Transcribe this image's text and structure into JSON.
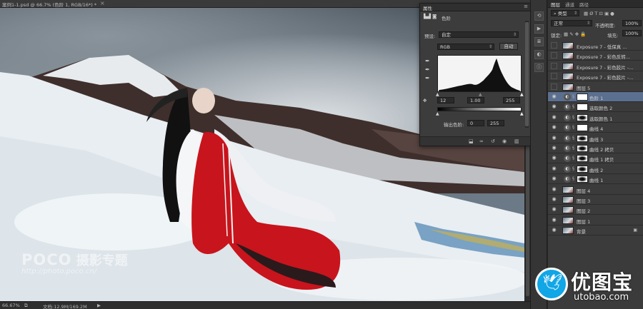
{
  "document": {
    "title": "案例1-1.psd @ 66.7% (色阶 1, RGB/16*) *",
    "close_glyph": "×"
  },
  "status_bar": {
    "zoom": "66.67%",
    "doc_size": "文档:12.9M/169.2M"
  },
  "watermark": {
    "brand": "POCO",
    "brand_cn": "摄影专题",
    "url": "http://photo.poco.cn/"
  },
  "properties": {
    "tab_label": "属性",
    "header_label": "色阶",
    "preset_label": "预设:",
    "preset_value": "自定",
    "channel_value": "RGB",
    "auto_button": "自动",
    "input_black": "12",
    "input_gamma": "1.00",
    "input_white": "255",
    "output_label": "输出色阶:",
    "output_black": "0",
    "output_white": "255"
  },
  "layers_panel": {
    "tabs": [
      "图层",
      "通道",
      "路径"
    ],
    "filter_type": "类型",
    "blend_mode": "正常",
    "opacity_label": "不透明度:",
    "opacity_value": "100%",
    "lock_label": "锁定:",
    "fill_label": "填充:",
    "fill_value": "100%",
    "layers": [
      {
        "name": "Exposure 7 - 低保真 ...",
        "visible": false,
        "kind": "image"
      },
      {
        "name": "Exposure 7 - 彩色反转...",
        "visible": false,
        "kind": "image"
      },
      {
        "name": "Exposure 7 - 彩色胶片 -...",
        "visible": false,
        "kind": "image"
      },
      {
        "name": "Exposure 7 - 彩色胶片 -...",
        "visible": false,
        "kind": "image"
      },
      {
        "name": "图层 5",
        "visible": false,
        "kind": "image"
      },
      {
        "name": "色阶 1",
        "visible": true,
        "kind": "adjust",
        "selected": true
      },
      {
        "name": "选取颜色 2",
        "visible": true,
        "kind": "adjust"
      },
      {
        "name": "选取颜色 1",
        "visible": true,
        "kind": "adjust",
        "dark_mask": true
      },
      {
        "name": "曲线 4",
        "visible": true,
        "kind": "adjust"
      },
      {
        "name": "曲线 3",
        "visible": true,
        "kind": "adjust",
        "dark_mask": true
      },
      {
        "name": "曲线 2 拷贝",
        "visible": true,
        "kind": "adjust",
        "dark_mask": true
      },
      {
        "name": "曲线 1 拷贝",
        "visible": true,
        "kind": "adjust",
        "dark_mask": true
      },
      {
        "name": "曲线 2",
        "visible": true,
        "kind": "adjust",
        "dark_mask": true
      },
      {
        "name": "曲线 1",
        "visible": true,
        "kind": "adjust",
        "dark_mask": true
      },
      {
        "name": "图层 4",
        "visible": true,
        "kind": "image"
      },
      {
        "name": "图层 3",
        "visible": true,
        "kind": "image"
      },
      {
        "name": "图层 2",
        "visible": true,
        "kind": "image"
      },
      {
        "name": "图层 1",
        "visible": true,
        "kind": "image"
      },
      {
        "name": "背景",
        "visible": true,
        "kind": "image",
        "locked": true
      }
    ]
  },
  "site_logo": {
    "cn": "优图宝",
    "en": "utobao.com"
  },
  "colors": {
    "selection": "#5b6f8f",
    "logo_blue": "#11a6e6",
    "dress_red": "#c8141c"
  }
}
